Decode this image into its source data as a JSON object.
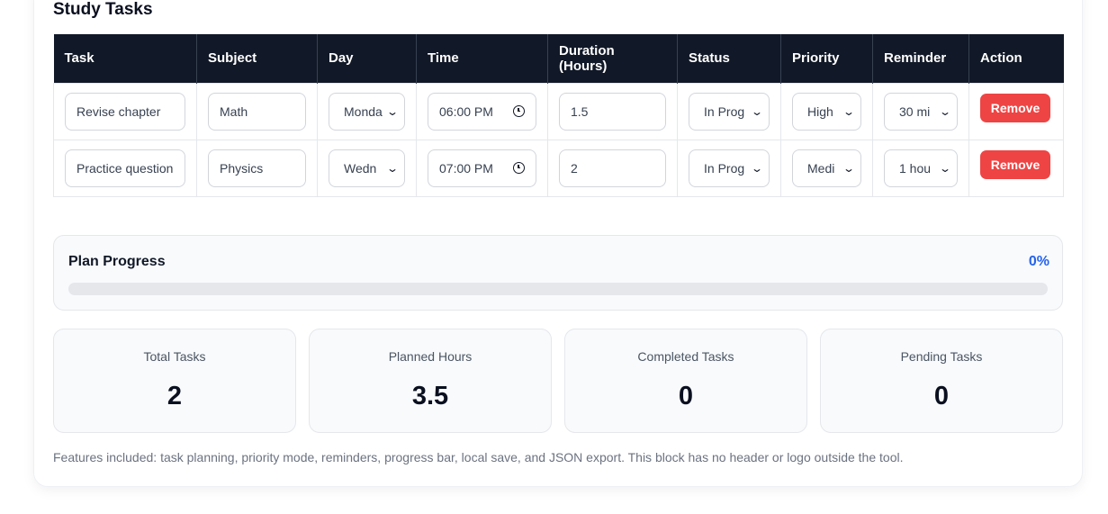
{
  "section_title": "Study Tasks",
  "table": {
    "headers": [
      "Task",
      "Subject",
      "Day",
      "Time",
      "Duration (Hours)",
      "Status",
      "Priority",
      "Reminder",
      "Action"
    ],
    "rows": [
      {
        "task": "Revise chapter",
        "subject": "Math",
        "day": "Monda",
        "time": "06:00 PM",
        "duration": "1.5",
        "status": "In Prog",
        "priority": "High",
        "reminder": "30 mi",
        "action": "Remove"
      },
      {
        "task": "Practice question",
        "subject": "Physics",
        "day": "Wedn",
        "time": "07:00 PM",
        "duration": "2",
        "status": "In Prog",
        "priority": "Medi",
        "reminder": "1 hou",
        "action": "Remove"
      }
    ]
  },
  "progress": {
    "label": "Plan Progress",
    "percent_text": "0%",
    "percent_value": 0
  },
  "stats": [
    {
      "label": "Total Tasks",
      "value": "2"
    },
    {
      "label": "Planned Hours",
      "value": "3.5"
    },
    {
      "label": "Completed Tasks",
      "value": "0"
    },
    {
      "label": "Pending Tasks",
      "value": "0"
    }
  ],
  "footnote": "Features included: task planning, priority mode, reminders, progress bar, local save, and JSON export. This block has no header or logo outside the tool.",
  "icons": {
    "time": "clock-icon",
    "select": "chevron-down-icon"
  },
  "colors": {
    "header_bg": "#111827",
    "remove_button": "#ef4444",
    "accent": "#2563eb"
  }
}
